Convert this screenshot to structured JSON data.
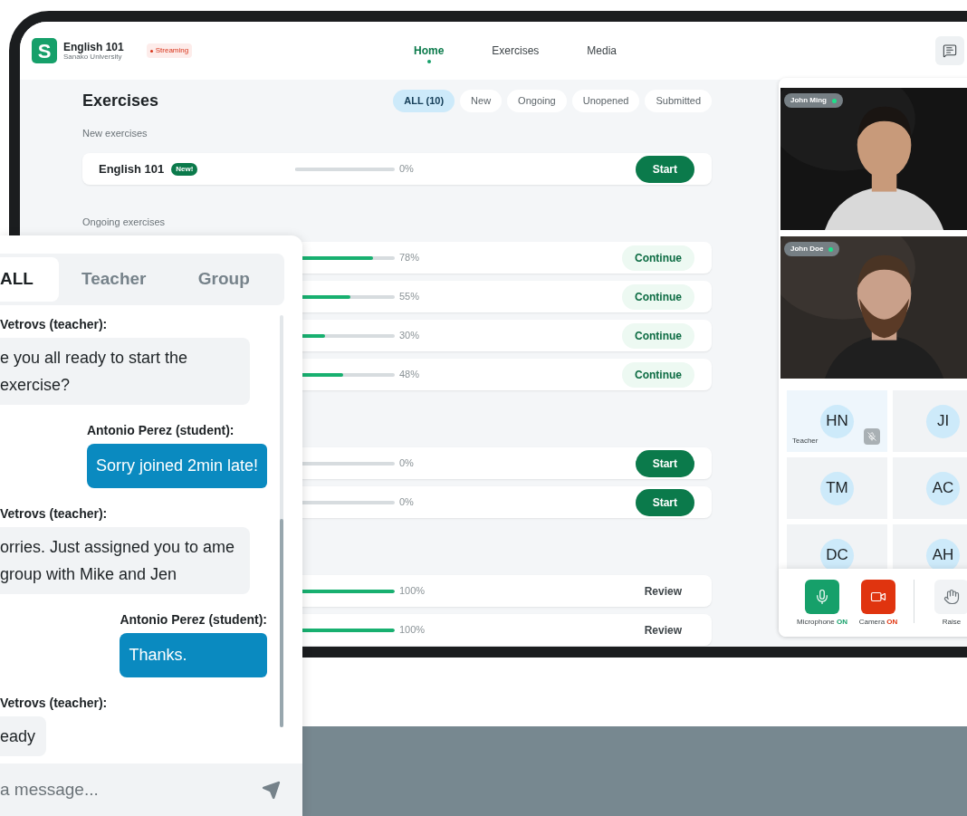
{
  "app": {
    "logo_letter": "S",
    "course_title": "English 101",
    "institution": "Sanako University",
    "status_badge": "Streaming"
  },
  "nav": [
    {
      "label": "Home",
      "selected": true
    },
    {
      "label": "Exercises",
      "selected": false
    },
    {
      "label": "Media",
      "selected": false
    }
  ],
  "page_title": "Exercises",
  "filters": [
    {
      "label": "ALL (10)",
      "selected": true
    },
    {
      "label": "New",
      "selected": false
    },
    {
      "label": "Ongoing",
      "selected": false
    },
    {
      "label": "Unopened",
      "selected": false
    },
    {
      "label": "Submitted",
      "selected": false
    }
  ],
  "sections": [
    {
      "heading": "New exercises",
      "rows": [
        {
          "title": "English 101",
          "badge": "New!",
          "level": 0,
          "reading": "0%",
          "action": {
            "label": "Start",
            "kind": "start"
          }
        }
      ]
    },
    {
      "heading": "Ongoing exercises",
      "rows": [
        {
          "level": 0.78,
          "reading": "78%",
          "action": {
            "label": "Continue",
            "kind": "continue"
          }
        },
        {
          "level": 0.55,
          "reading": "55%",
          "action": {
            "label": "Continue",
            "kind": "continue"
          }
        },
        {
          "level": 0.3,
          "reading": "30%",
          "action": {
            "label": "Continue",
            "kind": "continue"
          }
        },
        {
          "level": 0.48,
          "reading": "48%",
          "action": {
            "label": "Continue",
            "kind": "continue"
          }
        }
      ]
    },
    {
      "rows": [
        {
          "level": 0,
          "reading": "0%",
          "action": {
            "label": "Start",
            "kind": "start"
          }
        },
        {
          "level": 0,
          "reading": "0%",
          "action": {
            "label": "Start",
            "kind": "start"
          }
        }
      ]
    },
    {
      "rows": [
        {
          "level": 1,
          "reading": "100%",
          "action": {
            "label": "Review",
            "kind": "review"
          }
        },
        {
          "level": 1,
          "reading": "100%",
          "action": {
            "label": "Review",
            "kind": "review"
          }
        }
      ]
    }
  ],
  "videos": [
    {
      "name": "John Ming",
      "online": true,
      "kind": "picture"
    },
    {
      "name": "John Doe",
      "online": true,
      "kind": "picture"
    }
  ],
  "participants": [
    {
      "initials": "HN",
      "role": "Teacher",
      "muted": true
    },
    {
      "initials": "JI",
      "muted": false
    },
    {
      "initials": "TM",
      "muted": false
    },
    {
      "initials": "AC",
      "muted": false
    },
    {
      "initials": "DC",
      "muted": false
    },
    {
      "initials": "AH",
      "muted": false
    }
  ],
  "controls": [
    {
      "kind": "microphone",
      "label": "Microphone",
      "status": "ON",
      "color": "#16a06a"
    },
    {
      "kind": "camera",
      "label": "Camera",
      "status": "ON",
      "color": "#e0340f"
    },
    {
      "kind": "raise_hand",
      "label": "Raise"
    }
  ],
  "chat": {
    "tabs": [
      {
        "label": "ALL",
        "selected": true
      },
      {
        "label": "Teacher",
        "selected": false
      },
      {
        "label": "Group",
        "selected": false
      }
    ],
    "messages": [
      {
        "kind": "received",
        "sender": "Vetrovs (teacher):",
        "text": "e you all ready to start the exercise?"
      },
      {
        "kind": "sent",
        "sender": "Antonio Perez (student):",
        "text": "Sorry joined 2min late!"
      },
      {
        "kind": "received",
        "sender": "Vetrovs (teacher):",
        "text": "orries. Just assigned you to ame group with Mike and Jen"
      },
      {
        "kind": "sent",
        "sender": "Antonio Perez (student):",
        "text": "Thanks."
      },
      {
        "kind": "received",
        "sender": "Vetrovs (teacher):",
        "text": "eady"
      }
    ],
    "input": {
      "placeholder": "a message..."
    }
  }
}
